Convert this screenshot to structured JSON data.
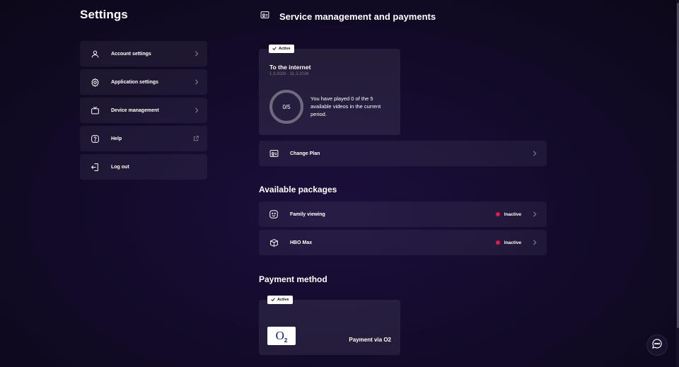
{
  "sidebar": {
    "title": "Settings",
    "items": [
      {
        "label": "Account settings",
        "icon": "user-icon",
        "trailing": "chevron-right-icon"
      },
      {
        "label": "Application settings",
        "icon": "gear-icon",
        "trailing": "chevron-right-icon"
      },
      {
        "label": "Device management",
        "icon": "tv-icon",
        "trailing": "chevron-right-icon"
      },
      {
        "label": "Help",
        "icon": "help-icon",
        "trailing": "external-link-icon"
      },
      {
        "label": "Log out",
        "icon": "logout-icon",
        "trailing": ""
      }
    ]
  },
  "main": {
    "title": "Service management and payments",
    "title_icon": "contract-icon",
    "current_plan": {
      "badge": "Active",
      "name": "To the internet",
      "dates": "1.3.2026 - 31.3.2026",
      "progress_text": "0/5",
      "played": 0,
      "total": 5,
      "description": "You have played 0 of the 5 available videos in the current period."
    },
    "change_plan": {
      "label": "Change Plan",
      "icon": "contract-icon"
    },
    "packages": {
      "title": "Available packages",
      "items": [
        {
          "label": "Family viewing",
          "icon": "family-face-icon",
          "status": "Inactive"
        },
        {
          "label": "HBO Max",
          "icon": "package-box-icon",
          "status": "Inactive"
        }
      ]
    },
    "payment": {
      "title": "Payment method",
      "badge": "Active",
      "logo_text": "O",
      "logo_sub": "2",
      "label": "Payment via O2"
    }
  },
  "colors": {
    "background": "#140b2c",
    "inactive_dot": "#e5194b",
    "o2_blue": "#0a2a6b"
  }
}
